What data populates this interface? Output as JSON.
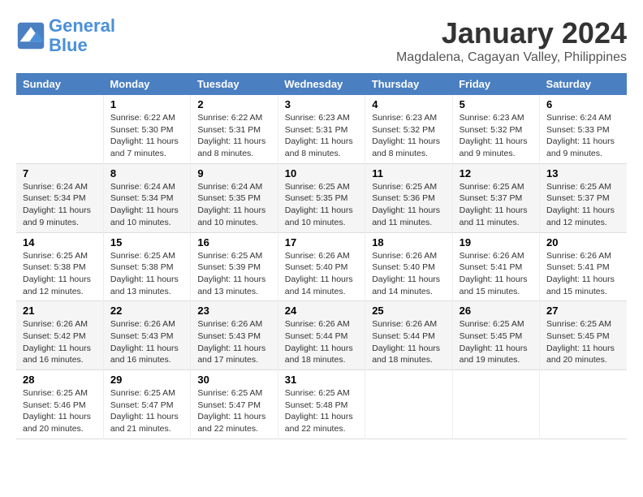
{
  "header": {
    "logo_line1": "General",
    "logo_line2": "Blue",
    "month": "January 2024",
    "location": "Magdalena, Cagayan Valley, Philippines"
  },
  "weekdays": [
    "Sunday",
    "Monday",
    "Tuesday",
    "Wednesday",
    "Thursday",
    "Friday",
    "Saturday"
  ],
  "weeks": [
    [
      {
        "num": "",
        "info": ""
      },
      {
        "num": "1",
        "info": "Sunrise: 6:22 AM\nSunset: 5:30 PM\nDaylight: 11 hours\nand 7 minutes."
      },
      {
        "num": "2",
        "info": "Sunrise: 6:22 AM\nSunset: 5:31 PM\nDaylight: 11 hours\nand 8 minutes."
      },
      {
        "num": "3",
        "info": "Sunrise: 6:23 AM\nSunset: 5:31 PM\nDaylight: 11 hours\nand 8 minutes."
      },
      {
        "num": "4",
        "info": "Sunrise: 6:23 AM\nSunset: 5:32 PM\nDaylight: 11 hours\nand 8 minutes."
      },
      {
        "num": "5",
        "info": "Sunrise: 6:23 AM\nSunset: 5:32 PM\nDaylight: 11 hours\nand 9 minutes."
      },
      {
        "num": "6",
        "info": "Sunrise: 6:24 AM\nSunset: 5:33 PM\nDaylight: 11 hours\nand 9 minutes."
      }
    ],
    [
      {
        "num": "7",
        "info": "Sunrise: 6:24 AM\nSunset: 5:34 PM\nDaylight: 11 hours\nand 9 minutes."
      },
      {
        "num": "8",
        "info": "Sunrise: 6:24 AM\nSunset: 5:34 PM\nDaylight: 11 hours\nand 10 minutes."
      },
      {
        "num": "9",
        "info": "Sunrise: 6:24 AM\nSunset: 5:35 PM\nDaylight: 11 hours\nand 10 minutes."
      },
      {
        "num": "10",
        "info": "Sunrise: 6:25 AM\nSunset: 5:35 PM\nDaylight: 11 hours\nand 10 minutes."
      },
      {
        "num": "11",
        "info": "Sunrise: 6:25 AM\nSunset: 5:36 PM\nDaylight: 11 hours\nand 11 minutes."
      },
      {
        "num": "12",
        "info": "Sunrise: 6:25 AM\nSunset: 5:37 PM\nDaylight: 11 hours\nand 11 minutes."
      },
      {
        "num": "13",
        "info": "Sunrise: 6:25 AM\nSunset: 5:37 PM\nDaylight: 11 hours\nand 12 minutes."
      }
    ],
    [
      {
        "num": "14",
        "info": "Sunrise: 6:25 AM\nSunset: 5:38 PM\nDaylight: 11 hours\nand 12 minutes."
      },
      {
        "num": "15",
        "info": "Sunrise: 6:25 AM\nSunset: 5:38 PM\nDaylight: 11 hours\nand 13 minutes."
      },
      {
        "num": "16",
        "info": "Sunrise: 6:25 AM\nSunset: 5:39 PM\nDaylight: 11 hours\nand 13 minutes."
      },
      {
        "num": "17",
        "info": "Sunrise: 6:26 AM\nSunset: 5:40 PM\nDaylight: 11 hours\nand 14 minutes."
      },
      {
        "num": "18",
        "info": "Sunrise: 6:26 AM\nSunset: 5:40 PM\nDaylight: 11 hours\nand 14 minutes."
      },
      {
        "num": "19",
        "info": "Sunrise: 6:26 AM\nSunset: 5:41 PM\nDaylight: 11 hours\nand 15 minutes."
      },
      {
        "num": "20",
        "info": "Sunrise: 6:26 AM\nSunset: 5:41 PM\nDaylight: 11 hours\nand 15 minutes."
      }
    ],
    [
      {
        "num": "21",
        "info": "Sunrise: 6:26 AM\nSunset: 5:42 PM\nDaylight: 11 hours\nand 16 minutes."
      },
      {
        "num": "22",
        "info": "Sunrise: 6:26 AM\nSunset: 5:43 PM\nDaylight: 11 hours\nand 16 minutes."
      },
      {
        "num": "23",
        "info": "Sunrise: 6:26 AM\nSunset: 5:43 PM\nDaylight: 11 hours\nand 17 minutes."
      },
      {
        "num": "24",
        "info": "Sunrise: 6:26 AM\nSunset: 5:44 PM\nDaylight: 11 hours\nand 18 minutes."
      },
      {
        "num": "25",
        "info": "Sunrise: 6:26 AM\nSunset: 5:44 PM\nDaylight: 11 hours\nand 18 minutes."
      },
      {
        "num": "26",
        "info": "Sunrise: 6:25 AM\nSunset: 5:45 PM\nDaylight: 11 hours\nand 19 minutes."
      },
      {
        "num": "27",
        "info": "Sunrise: 6:25 AM\nSunset: 5:45 PM\nDaylight: 11 hours\nand 20 minutes."
      }
    ],
    [
      {
        "num": "28",
        "info": "Sunrise: 6:25 AM\nSunset: 5:46 PM\nDaylight: 11 hours\nand 20 minutes."
      },
      {
        "num": "29",
        "info": "Sunrise: 6:25 AM\nSunset: 5:47 PM\nDaylight: 11 hours\nand 21 minutes."
      },
      {
        "num": "30",
        "info": "Sunrise: 6:25 AM\nSunset: 5:47 PM\nDaylight: 11 hours\nand 22 minutes."
      },
      {
        "num": "31",
        "info": "Sunrise: 6:25 AM\nSunset: 5:48 PM\nDaylight: 11 hours\nand 22 minutes."
      },
      {
        "num": "",
        "info": ""
      },
      {
        "num": "",
        "info": ""
      },
      {
        "num": "",
        "info": ""
      }
    ]
  ]
}
